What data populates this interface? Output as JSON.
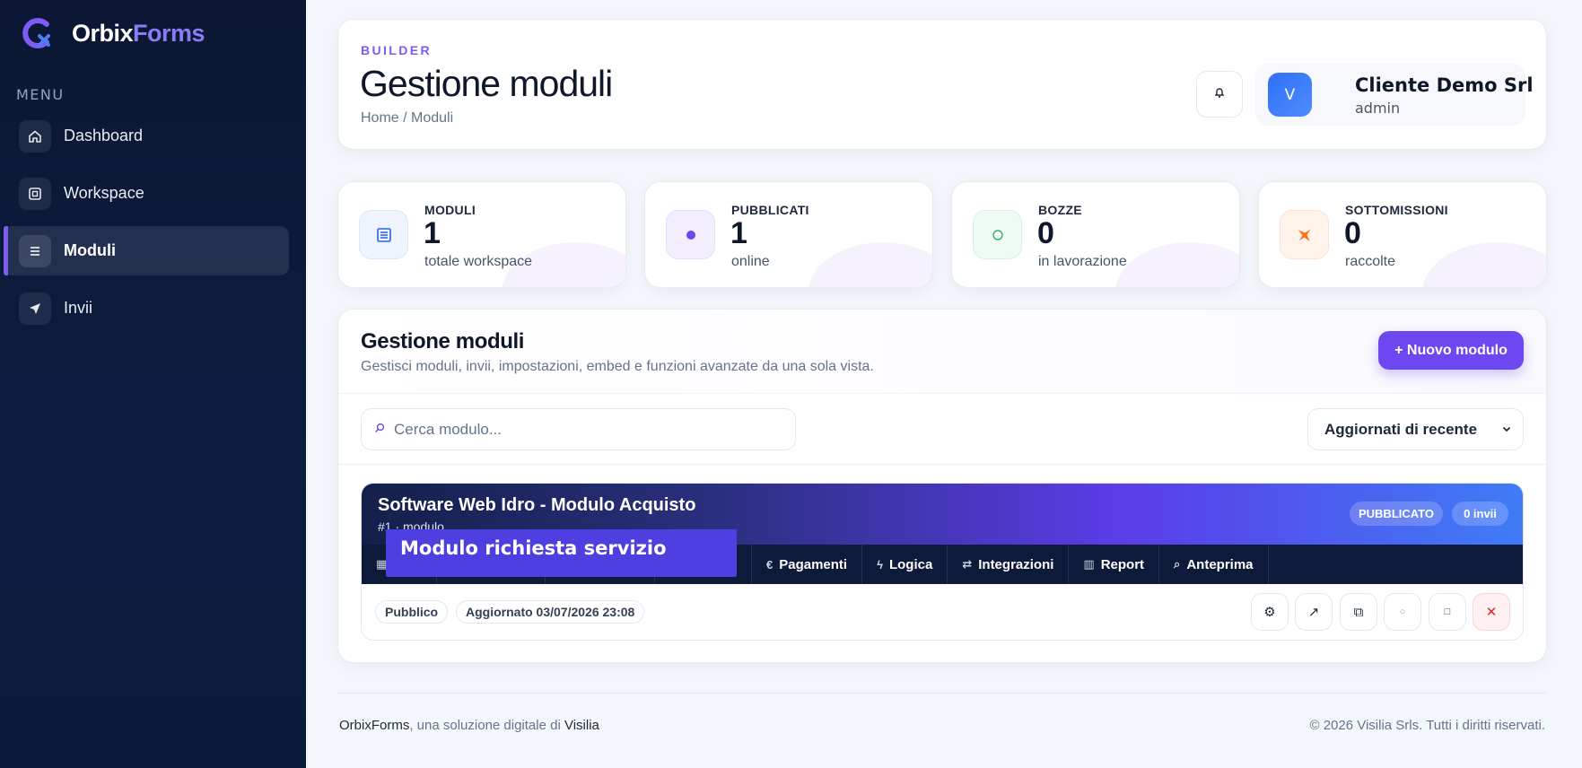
{
  "brand": {
    "name_part1": "Orbix",
    "name_part2": "Forms",
    "accent": "#7c5cf4"
  },
  "sidebar": {
    "menu_label": "MENU",
    "items": [
      {
        "label": "Dashboard",
        "icon": "home-icon",
        "active": false
      },
      {
        "label": "Workspace",
        "icon": "workspace-icon",
        "active": false
      },
      {
        "label": "Moduli",
        "icon": "list-icon",
        "active": true
      },
      {
        "label": "Invii",
        "icon": "send-icon",
        "active": false
      }
    ]
  },
  "header": {
    "eyebrow": "BUILDER",
    "title": "Gestione moduli",
    "breadcrumb": "Home / Moduli",
    "user": {
      "initial": "V",
      "name": "Cliente Demo Srl",
      "role": "admin"
    }
  },
  "stats": [
    {
      "label": "MODULI",
      "value": "1",
      "sub": "totale workspace",
      "icon": "list-icon"
    },
    {
      "label": "PUBBLICATI",
      "value": "1",
      "sub": "online",
      "icon": "dot-icon"
    },
    {
      "label": "BOZZE",
      "value": "0",
      "sub": "in lavorazione",
      "icon": "circle-icon"
    },
    {
      "label": "SOTTOMISSIONI",
      "value": "0",
      "sub": "raccolte",
      "icon": "plane-icon"
    }
  ],
  "panel": {
    "title": "Gestione moduli",
    "subtitle": "Gestisci moduli, invii, impostazioni, embed e funzioni avanzate da una sola vista.",
    "new_button": "+ Nuovo modulo",
    "search_placeholder": "Cerca modulo...",
    "sort_selected": "Aggiornati di recente"
  },
  "module": {
    "title": "Software Web Idro - Modulo Acquisto",
    "id_text": "#1 · modulo",
    "status_badge": "PUBBLICATO",
    "submissions_badge": "0 invii",
    "tabs": [
      {
        "label": "",
        "icon": "grid-icon"
      },
      {
        "label": "",
        "icon": ""
      },
      {
        "label": "",
        "icon": ""
      },
      {
        "label": "",
        "icon": ""
      },
      {
        "label": "Pagamenti",
        "icon": "euro-icon"
      },
      {
        "label": "Logica",
        "icon": "bolt-icon"
      },
      {
        "label": "Integrazioni",
        "icon": "exchange-icon"
      },
      {
        "label": "Report",
        "icon": "report-icon"
      },
      {
        "label": "Anteprima",
        "icon": "search-icon"
      }
    ],
    "visibility": "Pubblico",
    "updated": "Aggiornato 03/07/2026 23:08"
  },
  "tooltip": {
    "text": "Modulo richiesta servizio"
  },
  "footer": {
    "brand": "OrbixForms",
    "middle": ", una soluzione digitale di ",
    "company": "Visilia",
    "copyright": "© 2026 Visilia Srls. Tutti i diritti riservati."
  }
}
